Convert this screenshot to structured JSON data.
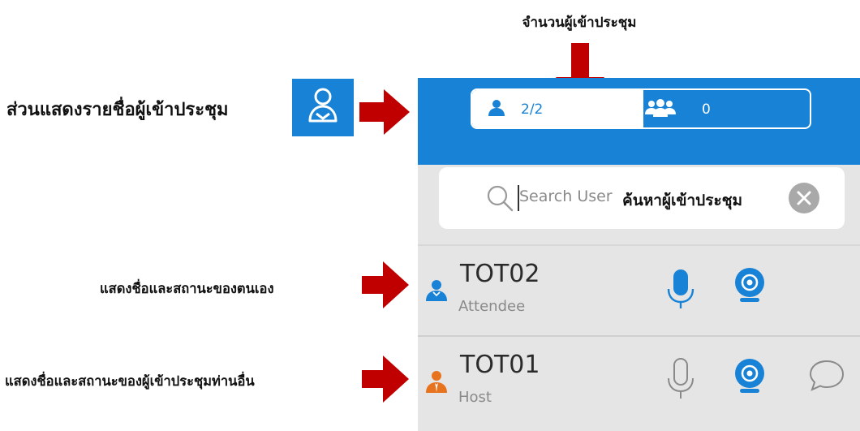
{
  "annotations": {
    "participant_count": "จำนวนผู้เข้าประชุม",
    "roster_section": "ส่วนแสดงรายชื่อผู้เข้าประชุม",
    "search_hint": "ค้นหาผู้เข้าประชุม",
    "self_row": "แสดงชื่อและสถานะของตนเอง",
    "other_row": "แสดงชื่อและสถานะของผู้เข้าประชุมท่านอื่น"
  },
  "tabs": {
    "attendees_count": "2/2",
    "groups_count": "0"
  },
  "search": {
    "placeholder": "Search User"
  },
  "participants": [
    {
      "name": "TOT02",
      "role": "Attendee",
      "icon": "user-icon",
      "mic": "mic-icon-active",
      "camera": "camera-icon-active"
    },
    {
      "name": "TOT01",
      "role": "Host",
      "icon": "host-user-icon",
      "mic": "mic-icon-outline",
      "camera": "camera-icon-active",
      "chat": "chat-icon"
    }
  ],
  "colors": {
    "header_blue": "#1782d6",
    "arrow_red": "#c00000",
    "host_orange": "#e8731f",
    "row_gray": "#e5e5e5"
  }
}
